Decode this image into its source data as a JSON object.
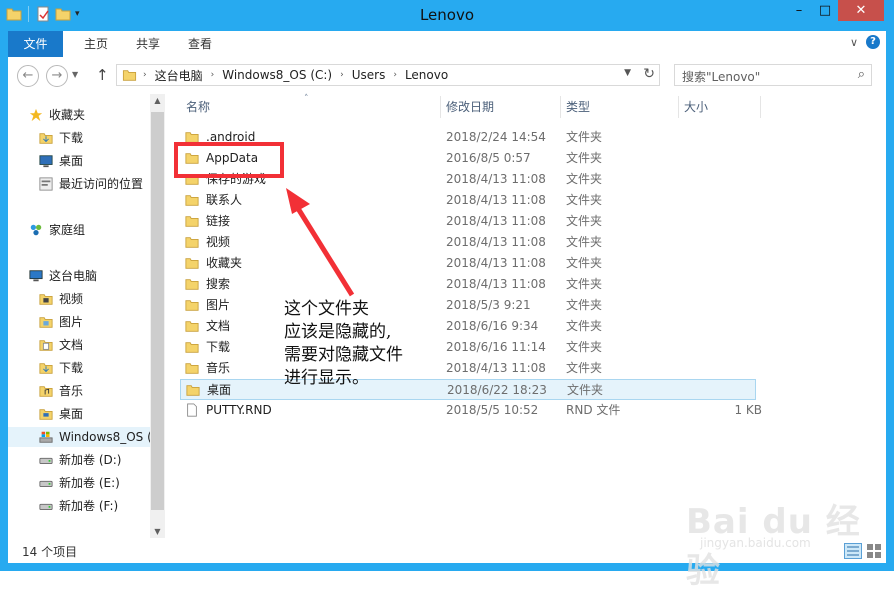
{
  "window": {
    "title": "Lenovo",
    "accent": "#27aaf0",
    "close_color": "#c7504b"
  },
  "ribbon": {
    "tabs": [
      "文件",
      "主页",
      "共享",
      "查看"
    ]
  },
  "address": {
    "crumbs": [
      "这台电脑",
      "Windows8_OS (C:)",
      "Users",
      "Lenovo"
    ],
    "search_placeholder": "搜索\"Lenovo\""
  },
  "nav": {
    "items": [
      {
        "label": "收藏夹",
        "icon": "star-icon"
      },
      {
        "label": "下载",
        "icon": "download-folder-icon"
      },
      {
        "label": "桌面",
        "icon": "desktop-icon"
      },
      {
        "label": "最近访问的位置",
        "icon": "recent-places-icon"
      },
      {
        "label": "家庭组",
        "icon": "homegroup-icon"
      },
      {
        "label": "这台电脑",
        "icon": "computer-icon"
      },
      {
        "label": "视频",
        "icon": "videos-folder-icon"
      },
      {
        "label": "图片",
        "icon": "pictures-folder-icon"
      },
      {
        "label": "文档",
        "icon": "documents-folder-icon"
      },
      {
        "label": "下载",
        "icon": "download-folder-icon"
      },
      {
        "label": "音乐",
        "icon": "music-folder-icon"
      },
      {
        "label": "桌面",
        "icon": "desktop-folder-icon"
      },
      {
        "label": "Windows8_OS (",
        "icon": "drive-c-icon"
      },
      {
        "label": "新加卷 (D:)",
        "icon": "drive-icon"
      },
      {
        "label": "新加卷 (E:)",
        "icon": "drive-icon"
      },
      {
        "label": "新加卷 (F:)",
        "icon": "drive-icon"
      }
    ]
  },
  "columns": {
    "name": "名称",
    "date": "修改日期",
    "type": "类型",
    "size": "大小"
  },
  "files": [
    {
      "name": ".android",
      "date": "2018/2/24 14:54",
      "type": "文件夹",
      "size": ""
    },
    {
      "name": "AppData",
      "date": "2016/8/5 0:57",
      "type": "文件夹",
      "size": ""
    },
    {
      "name": "保存的游戏",
      "date": "2018/4/13 11:08",
      "type": "文件夹",
      "size": ""
    },
    {
      "name": "联系人",
      "date": "2018/4/13 11:08",
      "type": "文件夹",
      "size": ""
    },
    {
      "name": "链接",
      "date": "2018/4/13 11:08",
      "type": "文件夹",
      "size": ""
    },
    {
      "name": "视频",
      "date": "2018/4/13 11:08",
      "type": "文件夹",
      "size": ""
    },
    {
      "name": "收藏夹",
      "date": "2018/4/13 11:08",
      "type": "文件夹",
      "size": ""
    },
    {
      "name": "搜索",
      "date": "2018/4/13 11:08",
      "type": "文件夹",
      "size": ""
    },
    {
      "name": "图片",
      "date": "2018/5/3 9:21",
      "type": "文件夹",
      "size": ""
    },
    {
      "name": "文档",
      "date": "2018/6/16 9:34",
      "type": "文件夹",
      "size": ""
    },
    {
      "name": "下载",
      "date": "2018/6/16 11:14",
      "type": "文件夹",
      "size": ""
    },
    {
      "name": "音乐",
      "date": "2018/4/13 11:08",
      "type": "文件夹",
      "size": ""
    },
    {
      "name": "桌面",
      "date": "2018/6/22 18:23",
      "type": "文件夹",
      "size": ""
    },
    {
      "name": "PUTTY.RND",
      "date": "2018/5/5 10:52",
      "type": "RND 文件",
      "size": "1 KB"
    }
  ],
  "status": {
    "count_text": "14 个项目"
  },
  "annotation": {
    "lines": [
      "这个文件夹",
      "应该是隐藏的,",
      "需要对隐藏文件",
      "进行显示。"
    ]
  },
  "watermark": {
    "main": "Bai du 经验",
    "sub": "jingyan.baidu.com"
  }
}
